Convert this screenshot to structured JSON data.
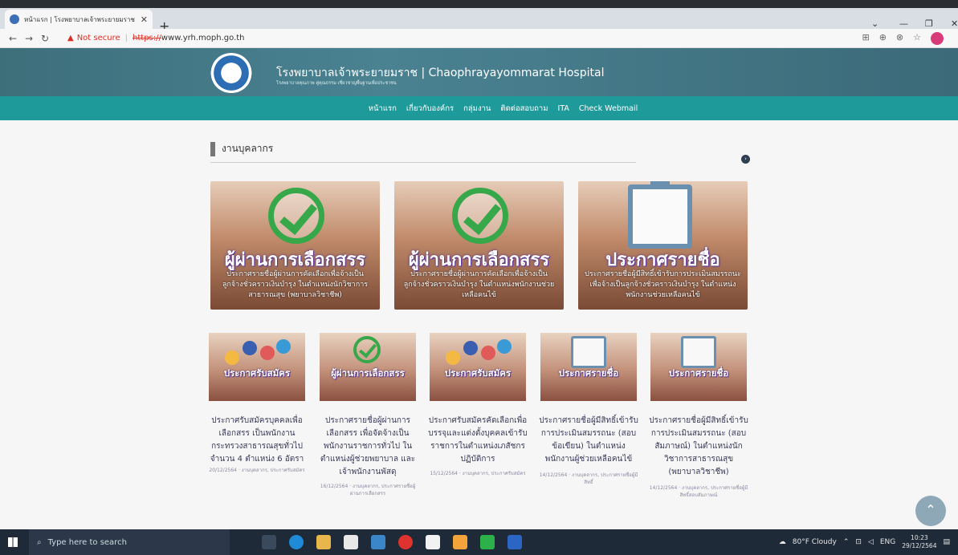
{
  "browser": {
    "tab_title": "หน้าแรก | โรงพยาบาลเจ้าพระยายมราช",
    "new_tab": "+",
    "not_secure": "Not secure",
    "url_scheme": "https://",
    "url_host": "www.yrh.moph.go.th"
  },
  "site": {
    "title": "โรงพยาบาลเจ้าพระยายมราช | Chaophrayayommarat Hospital",
    "subtitle": "โรงพยาบาลคุณภาพ คู่คุณธรรม เชี่ยวชาญพื้นฐานเพื่อประชาชน",
    "menu": [
      "หน้าแรก",
      "เกี่ยวกับองค์กร",
      "กลุ่มงาน",
      "ติดต่อสอบถาม",
      "ITA",
      "Check Webmail"
    ]
  },
  "section": {
    "title": "งานบุคลากร"
  },
  "big_cards": [
    {
      "headline": "ผู้ผ่านการเลือกสรร",
      "desc": "ประกาศรายชื่อผู้ผ่านการคัดเลือกเพื่อจ้างเป็นลูกจ้างชั่วคราวเงินบำรุง ในตำแหน่งนักวิชาการสาธารณสุข (พยาบาลวิชาชีพ)",
      "art": "check"
    },
    {
      "headline": "ผู้ผ่านการเลือกสรร",
      "desc": "ประกาศรายชื่อผู้ผ่านการคัดเลือกเพื่อจ้างเป็นลูกจ้างชั่วคราวเงินบำรุง ในตำแหน่งพนักงานช่วยเหลือคนไข้",
      "art": "check"
    },
    {
      "headline": "ประกาศรายชื่อ",
      "desc": "ประกาศรายชื่อผู้มีสิทธิ์เข้ารับการประเมินสมรรถนะเพื่อจ้างเป็นลูกจ้างชั่วคราวเงินบำรุง ในตำแหน่งพนักงานช่วยเหลือคนไข้",
      "art": "clipboard"
    }
  ],
  "small_cards": [
    {
      "head": "ประกาศรับสมัคร",
      "art": "people",
      "text": "ประกาศรับสมัครบุคคลเพื่อเลือกสรร เป็นพนักงานกระทรวงสาธารณสุขทั่วไป จำนวน 4 ตำแหน่ง 6 อัตรา",
      "meta": "20/12/2564 · งานบุคลากร, ประกาศรับสมัคร"
    },
    {
      "head": "ผู้ผ่านการเลือกสรร",
      "art": "check",
      "text": "ประกาศรายชื่อผู้ผ่านการเลือกสรร เพื่อจัดจ้างเป็นพนักงานราชการทั่วไป ในตำแหน่งผู้ช่วยพยาบาล และเจ้าพนักงานพัสดุ",
      "meta": "16/12/2564 · งานบุคลากร, ประกาศรายชื่อผู้ผ่านการเลือกสรร"
    },
    {
      "head": "ประกาศรับสมัคร",
      "art": "people",
      "text": "ประกาศรับสมัครคัดเลือกเพื่อบรรจุและแต่งตั้งบุคคลเข้ารับราชการในตำแหน่งเภสัชกรปฏิบัติการ",
      "meta": "15/12/2564 · งานบุคลากร, ประกาศรับสมัคร"
    },
    {
      "head": "ประกาศรายชื่อ",
      "art": "clipboard",
      "text": "ประกาศรายชื่อผู้มีสิทธิ์เข้ารับการประเมินสมรรถนะ (สอบข้อเขียน) ในตำแหน่งพนักงานผู้ช่วยเหลือคนไข้",
      "meta": "14/12/2564 · งานบุคลากร, ประกาศรายชื่อผู้มีสิทธิ์"
    },
    {
      "head": "ประกาศรายชื่อ",
      "art": "clipboard",
      "text": "ประกาศรายชื่อผู้มีสิทธิ์เข้ารับการประเมินสมรรถนะ (สอบสัมภาษณ์) ในตำแหน่งนักวิชาการสาธารณสุข (พยาบาลวิชาชีพ)",
      "meta": "14/12/2564 · งานบุคลากร, ประกาศรายชื่อผู้มีสิทธิ์สอบสัมภาษณ์"
    }
  ],
  "taskbar": {
    "search_placeholder": "Type here to search",
    "weather": "80°F Cloudy",
    "lang": "ENG",
    "time": "10:23",
    "date": "29/12/2564"
  },
  "colors": {
    "menu_bg": "#1e9a9a",
    "header_bg": "#4a8292",
    "check_green": "#37a84a",
    "taskbar_bg": "#1f2a38"
  }
}
